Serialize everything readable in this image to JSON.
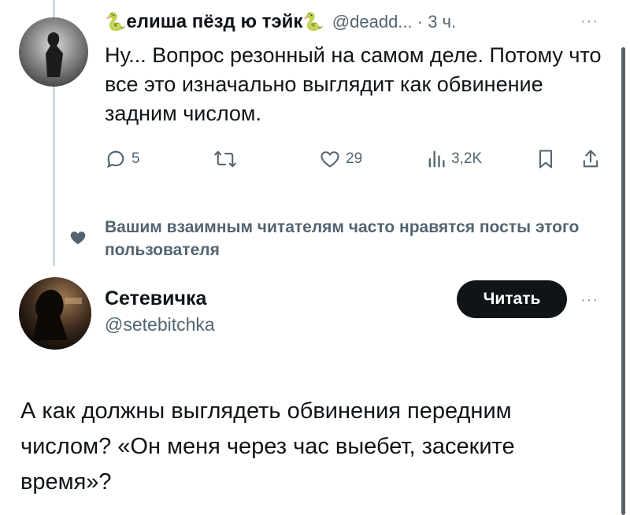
{
  "reply": {
    "author_name": "елиша пёзд ю тэйк",
    "name_emoji": "🐍",
    "meta": "@deadd... · 3 ч.",
    "more_glyph": "···",
    "text": "Ну... Вопрос резонный на самом деле. Потому что все это изначально выглядит как обвинение задним числом.",
    "actions": {
      "replies": "5",
      "likes": "29",
      "views": "3,2K"
    }
  },
  "suggestion": {
    "text": "Вашим взаимным читателям часто нравятся посты этого пользователя"
  },
  "post": {
    "user_name": "Сетевичка",
    "user_handle": "@setebitchka",
    "follow_label": "Читать",
    "more_glyph": "···",
    "text": "А как должны выглядеть обвинения передним числом? «Он меня через час выебет, засеките время»?"
  },
  "colors": {
    "text": "#0f1419",
    "secondary": "#536471",
    "line": "#cfd9de",
    "button_bg": "#0f1419"
  }
}
